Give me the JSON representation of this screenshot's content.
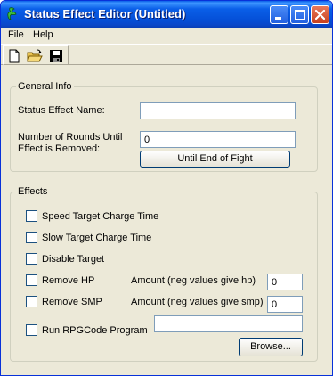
{
  "window": {
    "title": "Status Effect Editor (Untitled)",
    "controls": {
      "minimize": "minimize-icon",
      "maximize": "maximize-icon",
      "close": "close-icon"
    }
  },
  "menu": {
    "file": "File",
    "help": "Help"
  },
  "toolbar": {
    "icons": [
      "new-document-icon",
      "open-folder-icon",
      "save-disk-icon"
    ]
  },
  "general_info": {
    "legend": "General Info",
    "name_label": "Status Effect Name:",
    "name_value": "",
    "rounds_label_line1": "Number of Rounds Until",
    "rounds_label_line2": "Effect is Removed:",
    "rounds_value": "0",
    "until_end_button": "Until End of Fight"
  },
  "effects": {
    "legend": "Effects",
    "speed_label": "Speed Target Charge Time",
    "speed_checked": false,
    "slow_label": "Slow Target Charge Time",
    "slow_checked": false,
    "disable_label": "Disable Target",
    "disable_checked": false,
    "remove_hp_label": "Remove HP",
    "remove_hp_checked": false,
    "hp_amount_label": "Amount (neg values give hp)",
    "hp_amount_value": "0",
    "remove_smp_label": "Remove SMP",
    "remove_smp_checked": false,
    "smp_amount_label": "Amount (neg values give smp)",
    "smp_amount_value": "0",
    "run_prg_label": "Run RPGCode Program",
    "run_prg_checked": false,
    "program_value": "",
    "browse_button": "Browse..."
  }
}
